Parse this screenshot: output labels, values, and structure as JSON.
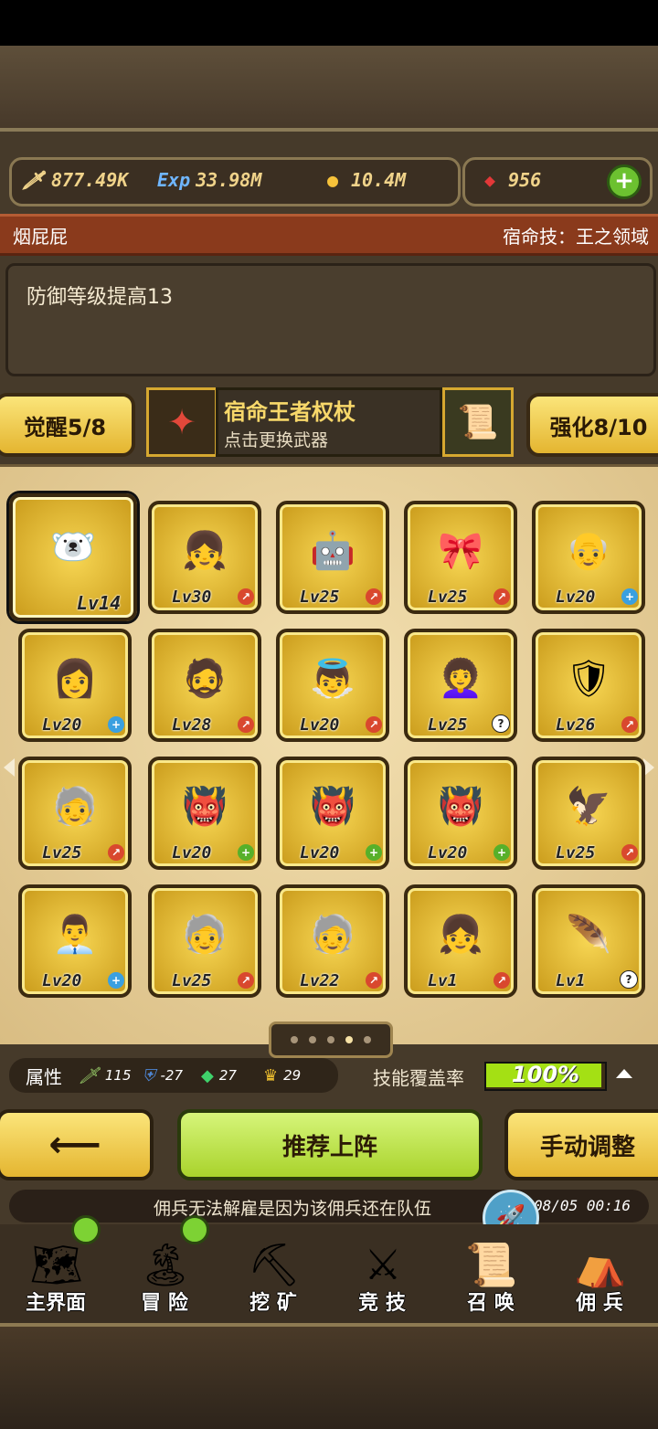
{
  "resources": {
    "attack": "877.49K",
    "exp_label": "Exp",
    "exp": "33.98M",
    "gold": "10.4M",
    "gems": "956"
  },
  "hero": {
    "name": "烟屁屁",
    "fate_skill": "宿命技：王之领域",
    "description": "防御等级提高13"
  },
  "buttons": {
    "awaken": "觉醒5/8",
    "enhance": "强化8/10",
    "recommend": "推荐上阵",
    "manual": "手动调整"
  },
  "weapon": {
    "name": "宿命王者权杖",
    "hint": "点击更换武器"
  },
  "mercenaries": [
    {
      "level": "Lv14",
      "icon": "polar-bear",
      "badge": "",
      "selected": true
    },
    {
      "level": "Lv30",
      "icon": "brown-hair-girl",
      "badge": "arrow-up"
    },
    {
      "level": "Lv25",
      "icon": "armored-robot",
      "badge": "arrow-up"
    },
    {
      "level": "Lv25",
      "icon": "blue-ribbon-girl",
      "badge": "arrow-up"
    },
    {
      "level": "Lv20",
      "icon": "bald-old-man",
      "badge": "plus-blue"
    },
    {
      "level": "Lv20",
      "icon": "purple-dress-girl",
      "badge": "plus-blue"
    },
    {
      "level": "Lv28",
      "icon": "white-hair-warrior",
      "badge": "arrow-up"
    },
    {
      "level": "Lv20",
      "icon": "blonde-angel",
      "badge": "arrow-up"
    },
    {
      "level": "Lv25",
      "icon": "black-hair-girl",
      "badge": "question"
    },
    {
      "level": "Lv26",
      "icon": "blonde-knight",
      "badge": "arrow-up"
    },
    {
      "level": "Lv25",
      "icon": "grey-hair-elder",
      "badge": "arrow-up"
    },
    {
      "level": "Lv20",
      "icon": "red-hood",
      "badge": "plus-green"
    },
    {
      "level": "Lv20",
      "icon": "red-hood",
      "badge": "plus-green"
    },
    {
      "level": "Lv20",
      "icon": "red-hood",
      "badge": "plus-green"
    },
    {
      "level": "Lv25",
      "icon": "red-mask-winged",
      "badge": "arrow-up"
    },
    {
      "level": "Lv20",
      "icon": "bald-suit-man",
      "badge": "plus-blue"
    },
    {
      "level": "Lv25",
      "icon": "grey-hair-elder",
      "badge": "arrow-up"
    },
    {
      "level": "Lv22",
      "icon": "grey-hair-elder",
      "badge": "arrow-up"
    },
    {
      "level": "Lv1",
      "icon": "brown-hair-girl",
      "badge": "arrow-up"
    },
    {
      "level": "Lv1",
      "icon": "bird-totem",
      "badge": "question"
    }
  ],
  "pager": {
    "count": 5,
    "active_index": 3
  },
  "attributes": {
    "label": "属性",
    "items": [
      {
        "icon": "sword-icon",
        "value": "115"
      },
      {
        "icon": "shield-icon",
        "value": "-27"
      },
      {
        "icon": "gem-icon",
        "value": "27"
      },
      {
        "icon": "crown-icon",
        "value": "29"
      }
    ]
  },
  "skill_coverage": {
    "label": "技能覆盖率",
    "value": "100%",
    "fraction": 1.0
  },
  "ticker": {
    "text": "佣兵无法解雇是因为该佣兵还在队伍",
    "datetime": "08/05 00:16"
  },
  "nav": [
    {
      "label": "主界面",
      "icon": "map-scroll-icon",
      "dot": true
    },
    {
      "label": "冒 险",
      "icon": "island-icon",
      "dot": true
    },
    {
      "label": "挖 矿",
      "icon": "pickaxe-icon",
      "dot": false
    },
    {
      "label": "竞 技",
      "icon": "crossed-swords-icon",
      "dot": false
    },
    {
      "label": "召 唤",
      "icon": "scroll-icon",
      "dot": false
    },
    {
      "label": "佣 兵",
      "icon": "tent-icon",
      "dot": false
    }
  ],
  "colors": {
    "accent_gold": "#f0d38a",
    "coverage_green": "#a4e014",
    "name_bar": "#8a3a1c"
  }
}
